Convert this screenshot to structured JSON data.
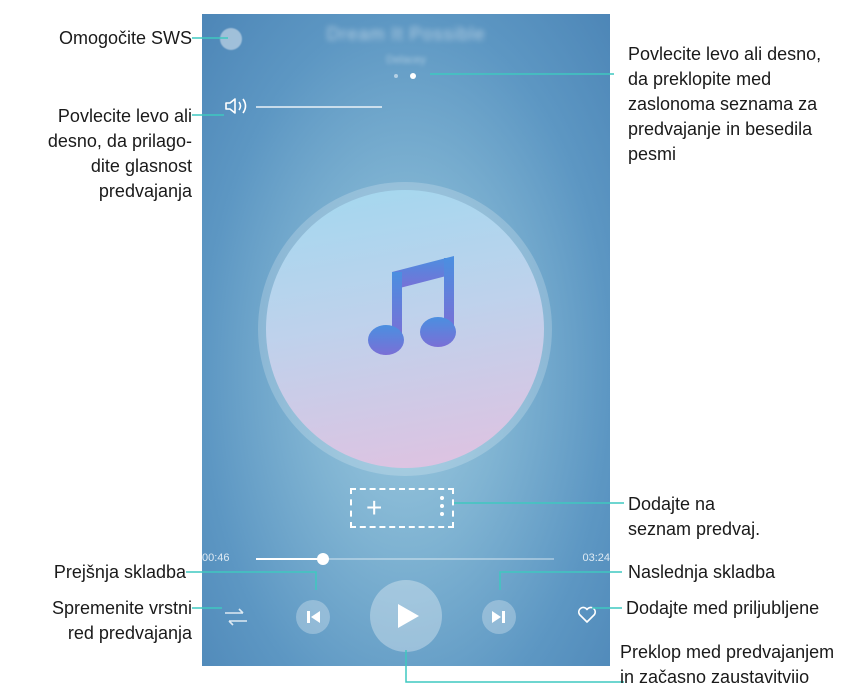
{
  "callouts": {
    "sws": "Omogočite SWS",
    "volume": [
      "Povlecite levo ali",
      "desno, da prilago-",
      "dite glasnost",
      "predvajanja"
    ],
    "swipe_screens": [
      "Povlecite levo ali desno,",
      "da preklopite med",
      "zaslonoma seznama za",
      "predvajanje in besedila",
      "pesmi"
    ],
    "add_playlist": [
      "Dodajte na",
      "seznam predvaj."
    ],
    "previous": "Prejšnja skladba",
    "next": "Naslednja skladba",
    "order": [
      "Spremenite vrstni",
      "red predvajanja"
    ],
    "favorite": "Dodajte med priljubljene",
    "play_pause": [
      "Preklop med predvajanjem",
      "in začasno zaustavitviio"
    ]
  },
  "player": {
    "song_title": "Dream It Possible",
    "artist": "Delacey",
    "elapsed": "00:46",
    "duration": "03:24",
    "progress": 0.225,
    "volume_level": 1.0,
    "page_indicator": {
      "count": 2,
      "active": 1
    }
  },
  "icons": {
    "sws": "sws-icon",
    "volume": "volume-icon",
    "note": "music-note-icon",
    "add": "plus-icon",
    "more": "more-vertical-icon",
    "previous": "previous-track-icon",
    "play": "play-icon",
    "next": "next-track-icon",
    "shuffle": "play-order-icon",
    "favorite": "heart-icon"
  },
  "colors": {
    "callout_line": "#3fc8c0",
    "background_top": "#4d86b7",
    "disc_gradient": [
      "#a2d8ef",
      "#e1c1e0"
    ],
    "note_gradient": [
      "#4b8fe0",
      "#7a6fd6"
    ]
  }
}
